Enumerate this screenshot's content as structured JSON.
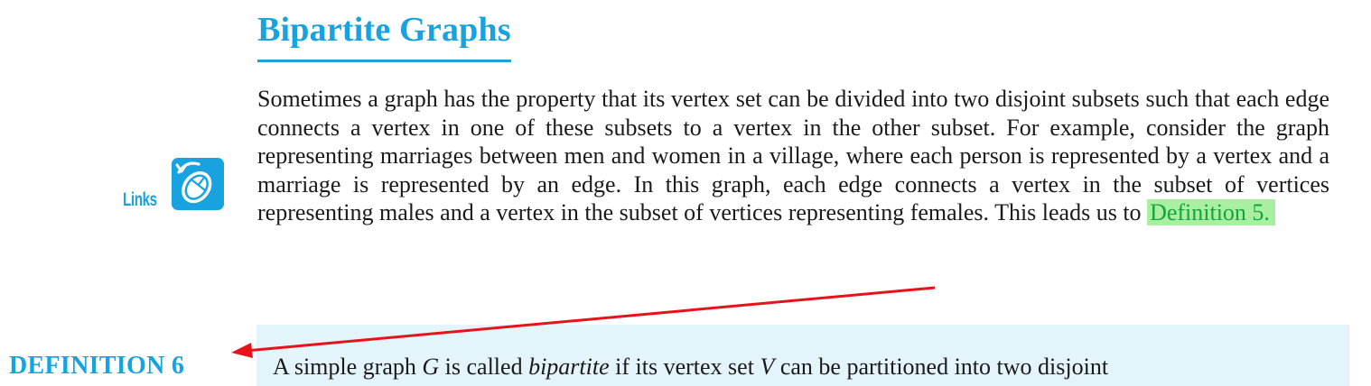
{
  "heading": "Bipartite Graphs",
  "links_label": "Links",
  "paragraph": {
    "lines": [
      "Sometimes a graph has the property that its vertex set can be divided into two disjoint subsets",
      "such that each edge connects a vertex in one of these subsets to a vertex in the other subset.",
      "For example, consider the graph representing marriages between men and women in a village,",
      "where each person is represented by a vertex and a marriage is represented by an edge. In this",
      "graph, each edge connects a vertex in the subset of vertices representing males and a vertex in"
    ],
    "last_line_prefix": "the subset of vertices representing females. This leads us to ",
    "link_text": "Definition 5."
  },
  "definition": {
    "label": "DEFINITION 6",
    "text_parts": {
      "a": "A simple graph ",
      "g": "G",
      "b": " is called ",
      "term": "bipartite",
      "c": " if its vertex set ",
      "v": "V",
      "d": " can be partitioned into two disjoint"
    }
  },
  "colors": {
    "accent": "#18a3e0",
    "highlight_bg": "#a8f0a0",
    "highlight_text": "#16a23c",
    "arrow": "#e8121a",
    "definition_bg": "#e4f4fb"
  }
}
